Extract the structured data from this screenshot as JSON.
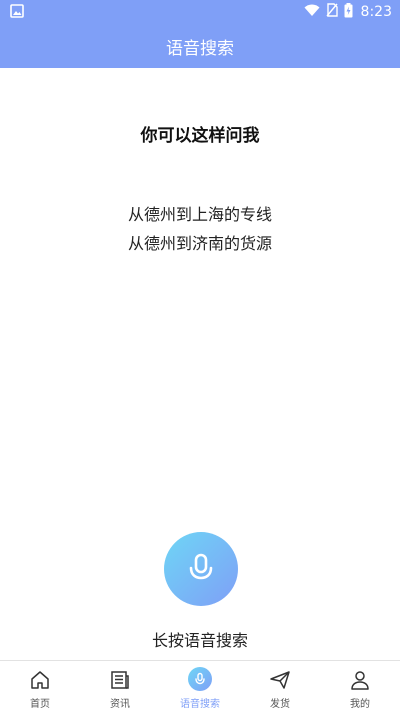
{
  "status_bar": {
    "time": "8:23",
    "left_icon": "image-icon",
    "right_icons": [
      "wifi-icon",
      "no-sim-icon",
      "battery-charging-icon"
    ]
  },
  "header": {
    "title": "语音搜索"
  },
  "hint": {
    "title": "你可以这样问我",
    "examples": [
      "从德州到上海的专线",
      "从德州到济南的货源"
    ]
  },
  "mic": {
    "caption": "长按语音搜索",
    "icon": "microphone-icon"
  },
  "bottom_nav": {
    "items": [
      {
        "label": "首页",
        "icon": "home-icon",
        "active": false
      },
      {
        "label": "资讯",
        "icon": "news-icon",
        "active": false
      },
      {
        "label": "语音搜索",
        "icon": "microphone-icon",
        "active": true
      },
      {
        "label": "发货",
        "icon": "send-icon",
        "active": false
      },
      {
        "label": "我的",
        "icon": "user-icon",
        "active": false
      }
    ]
  },
  "colors": {
    "accent": "#7f9ff7",
    "gradient_start": "#6ed6f5"
  }
}
